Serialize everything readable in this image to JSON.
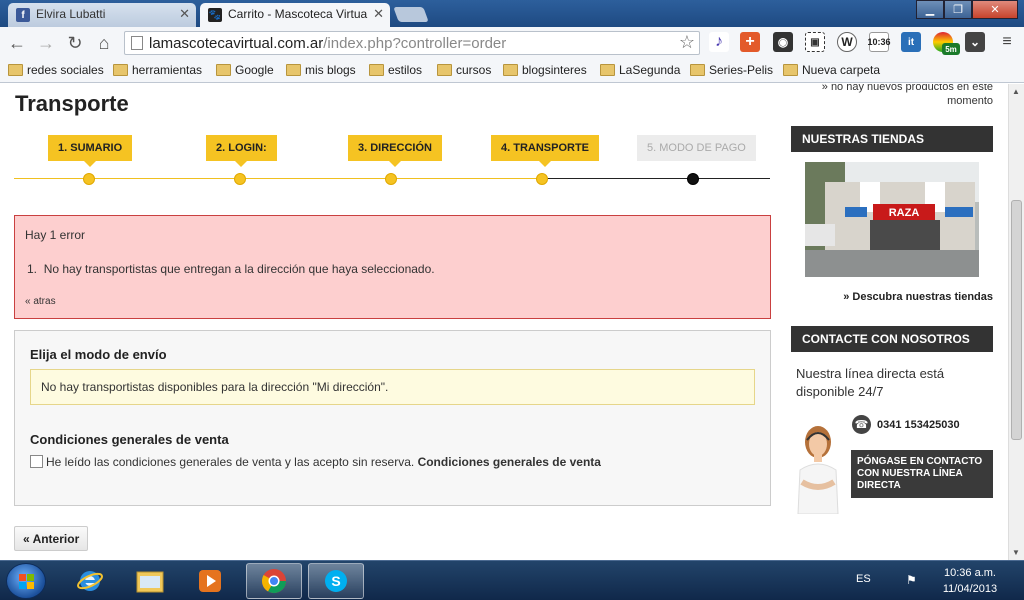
{
  "browser": {
    "tabs": [
      {
        "title": "Elvira Lubatti",
        "active": false
      },
      {
        "title": "Carrito - Mascoteca Virtua",
        "active": true
      }
    ],
    "url_host": "lamascotecavirtual.com.ar",
    "url_path": "/index.php?controller=order",
    "ext_labels": {
      "clock": "10:36",
      "it": "it",
      "badge": "5m"
    },
    "bookmarks": [
      "redes sociales",
      "herramientas",
      "Google",
      "mis blogs",
      "estilos",
      "cursos",
      "blogsinteres",
      "LaSegunda",
      "Series-Pelis",
      "Nueva carpeta"
    ]
  },
  "page": {
    "title": "Transporte",
    "steps": [
      {
        "label": "1. SUMARIO",
        "state": "done"
      },
      {
        "label": "2. LOGIN:",
        "state": "done"
      },
      {
        "label": "3. DIRECCIÓN",
        "state": "done"
      },
      {
        "label": "4. TRANSPORTE",
        "state": "current"
      },
      {
        "label": "5. MODO DE PAGO",
        "state": "pending"
      }
    ],
    "error": {
      "title": "Hay 1 error",
      "item_number": "1.",
      "item": "No hay transportistas que entregan a la dirección que haya seleccionado.",
      "back_link": "« atras"
    },
    "shipping": {
      "heading": "Elija el modo de envío",
      "warning": "No hay transportistas disponibles para la dirección \"Mi dirección\".",
      "terms_heading": "Condiciones generales de venta",
      "terms_text": "He leído las condiciones generales de venta y las acepto sin reserva.",
      "terms_link": "Condiciones generales de venta",
      "terms_checked": false
    },
    "prev_button": "« Anterior"
  },
  "sidebar": {
    "top_note": "» no hay nuevos productos en este momento",
    "stores_heading": "NUESTRAS TIENDAS",
    "store_sign": "RAZA",
    "stores_link": "» Descubra nuestras tiendas",
    "contact_heading": "CONTACTE CON NOSOTROS",
    "contact_text": "Nuestra línea directa está disponible 24/7",
    "phone": "0341 153425030",
    "contact_button": "PÓNGASE EN CONTACTO CON NUESTRA LÍNEA DIRECTA"
  },
  "taskbar": {
    "language": "ES",
    "time": "10:36 a.m.",
    "date": "11/04/2013"
  },
  "colors": {
    "accent_yellow": "#f5c322",
    "error_bg": "#fdcfcf",
    "error_border": "#c94040",
    "sidebar_head": "#333333"
  }
}
